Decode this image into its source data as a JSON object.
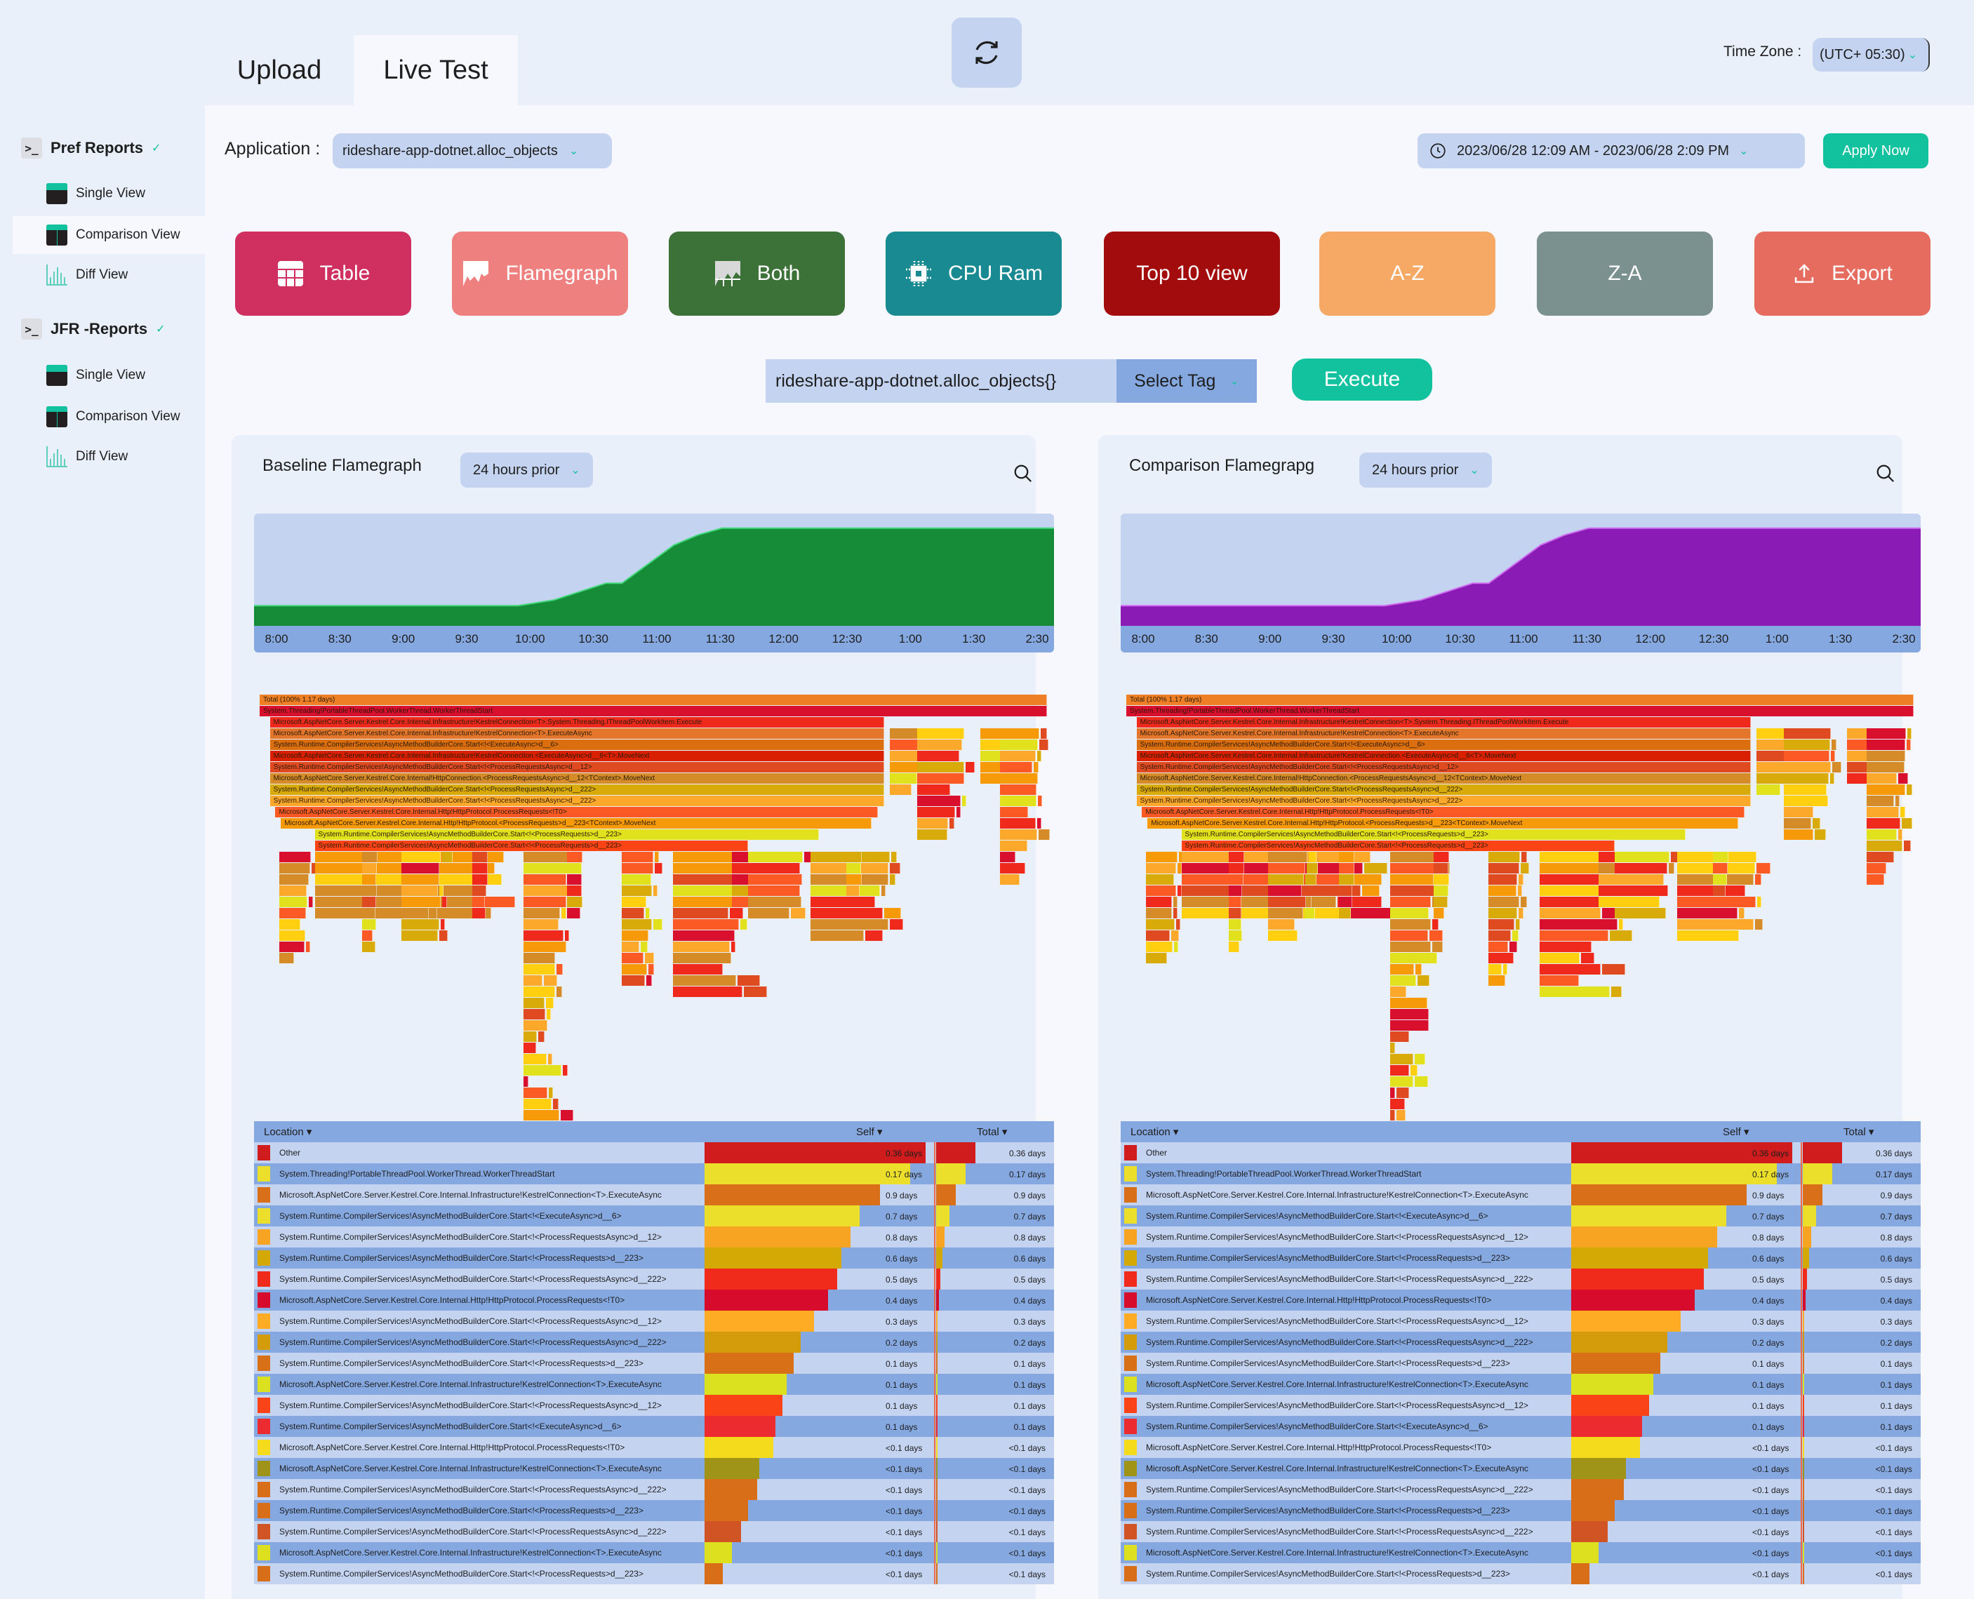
{
  "tabs": [
    {
      "label": "Upload",
      "active": false
    },
    {
      "label": "Live Test",
      "active": true
    }
  ],
  "refresh_icon": "refresh-icon",
  "timezone": {
    "label": "Time Zone :",
    "value": "(UTC+ 05:30)"
  },
  "sidebar": {
    "groups": [
      {
        "title": "Pref Reports",
        "items": [
          {
            "label": "Single View",
            "icon": "single-view-icon",
            "active": false
          },
          {
            "label": "Comparison View",
            "icon": "comparison-view-icon",
            "active": true
          },
          {
            "label": "Diff View",
            "icon": "diff-view-icon",
            "active": false
          }
        ]
      },
      {
        "title": "JFR -Reports",
        "items": [
          {
            "label": "Single View",
            "icon": "single-view-icon",
            "active": false
          },
          {
            "label": "Comparison View",
            "icon": "comparison-view-icon",
            "active": false
          },
          {
            "label": "Diff View",
            "icon": "diff-view-icon",
            "active": false
          }
        ]
      }
    ]
  },
  "application": {
    "label": "Application :",
    "value": "rideshare-app-dotnet.alloc_objects"
  },
  "date_range": {
    "value": "2023/06/28  12:09 AM - 2023/06/28  2:09 PM"
  },
  "apply_label": "Apply Now",
  "view_buttons": [
    {
      "label": "Table",
      "icon": "table-icon",
      "color": "#d03060"
    },
    {
      "label": "Flamegraph",
      "icon": "flamegraph-icon",
      "color": "#ee8080"
    },
    {
      "label": "Both",
      "icon": "both-icon",
      "color": "#3c7138"
    },
    {
      "label": "CPU Ram",
      "icon": "cpu-icon",
      "color": "#1a8a92"
    },
    {
      "label": "Top 10 view",
      "icon": "",
      "color": "#a20c0c"
    },
    {
      "label": "A-Z",
      "icon": "",
      "color": "#f5a964"
    },
    {
      "label": "Z-A",
      "icon": "",
      "color": "#7a9190"
    },
    {
      "label": "Export",
      "icon": "export-icon",
      "color": "#e66c60"
    }
  ],
  "query": {
    "value": "rideshare-app-dotnet.alloc_objects{}",
    "tag_label": "Select Tag",
    "execute_label": "Execute"
  },
  "panels": [
    {
      "title": "Baseline Flamegraph",
      "range": "24 hours  prior",
      "fill": "#178c38",
      "stroke": "#42d97a"
    },
    {
      "title": "Comparison Flamegrapg",
      "range": "24 hours  prior",
      "fill": "#8a1bb5",
      "stroke": "#d070f0"
    }
  ],
  "timeline": {
    "ticks": [
      "8:00",
      "8:30",
      "9:00",
      "9:30",
      "10:00",
      "10:30",
      "11:00",
      "11:30",
      "12:00",
      "12:30",
      "1:00",
      "1:30",
      "2:30"
    ],
    "points": [
      [
        0,
        0.18
      ],
      [
        0.33,
        0.18
      ],
      [
        0.375,
        0.23
      ],
      [
        0.44,
        0.38
      ],
      [
        0.46,
        0.38
      ],
      [
        0.525,
        0.72
      ],
      [
        0.555,
        0.81
      ],
      [
        0.585,
        0.87
      ],
      [
        1.0,
        0.87
      ]
    ]
  },
  "flamegraph": {
    "rows": [
      {
        "label": "Total  (100% 1.17 days)",
        "start": 0.0,
        "width": 1.0,
        "color": "#ef7f24"
      },
      {
        "label": "System.Threading!PortableThreadPool.WorkerThread.WorkerThreadStart",
        "start": 0.0,
        "width": 1.0,
        "color": "#d80f2d"
      },
      {
        "label": "Microsoft.AspNetCore.Server.Kestrel.Core.Internal.Infrastructure!KestrelConnection<T>.System.Threading.IThreadPoolWorkItem.Execute",
        "start": 0.013,
        "width": 0.78,
        "color": "#ef2a1c"
      },
      {
        "label": "Microsoft.AspNetCore.Server.Kestrel.Core.Internal.Infrastructure!KestrelConnection<T>.ExecuteAsync",
        "start": 0.013,
        "width": 0.78,
        "color": "#e3762a"
      },
      {
        "label": "System.Runtime.CompilerServices!AsyncMethodBuilderCore.Start<!<ExecuteAsync>d__6>",
        "start": 0.013,
        "width": 0.78,
        "color": "#db6f10"
      },
      {
        "label": "Microsoft.AspNetCore.Server.Kestrel.Core.Internal.Infrastructure!KestrelConnection.<ExecuteAsync>d__6<T>.MoveNext",
        "start": 0.013,
        "width": 0.78,
        "color": "#d92000"
      },
      {
        "label": "System.Runtime.CompilerServices!AsyncMethodBuilderCore.Start<!<ProcessRequestsAsync>d__12>",
        "start": 0.013,
        "width": 0.78,
        "color": "#e04a20"
      },
      {
        "label": "Microsoft.AspNetCore.Server.Kestrel.Core.Internal!HttpConnection.<ProcessRequestsAsync>d__12<TContext>.MoveNext",
        "start": 0.013,
        "width": 0.78,
        "color": "#d58b28"
      },
      {
        "label": "System.Runtime.CompilerServices!AsyncMethodBuilderCore.Start<!<ProcessRequestsAsync>d__222>",
        "start": 0.013,
        "width": 0.78,
        "color": "#d8aa0a"
      },
      {
        "label": "System.Runtime.CompilerServices!AsyncMethodBuilderCore.Start<!<ProcessRequestsAsync>d__222>",
        "start": 0.013,
        "width": 0.78,
        "color": "#fca82a"
      },
      {
        "label": "Microsoft.AspNetCore.Server.Kestrel.Core.Internal.Http!HttpProtocol.ProcessRequests<!T0>",
        "start": 0.02,
        "width": 0.765,
        "color": "#fb5a24"
      },
      {
        "label": "Microsoft.AspNetCore.Server.Kestrel.Core.Internal.Http!HttpProtocol.<ProcessRequests>d__223<TContext>.MoveNext",
        "start": 0.027,
        "width": 0.75,
        "color": "#f69a0a"
      },
      {
        "label": "System.Runtime.CompilerServices!AsyncMethodBuilderCore.Start<!<ProcessRequests>d__223>",
        "start": 0.07,
        "width": 0.64,
        "color": "#e1e11e"
      },
      {
        "label": "System.Runtime.CompilerServices!AsyncMethodBuilderCore.Start<!<ProcessRequests>d__223>",
        "start": 0.07,
        "width": 0.55,
        "color": "#fb4416"
      }
    ]
  },
  "table": {
    "headers": {
      "location": "Location ▾",
      "self": "Self ▾",
      "total": "Total ▾"
    },
    "rows": [
      {
        "color": "#d01c1c",
        "location": "Other",
        "self": "0.36 days",
        "total": "0.36 days",
        "self_frac": 0.97,
        "total_frac": 0.36
      },
      {
        "color": "#ebdf2c",
        "location": "System.Threading!PortableThreadPool.WorkerThread.WorkerThreadStart",
        "self": "0.17 days",
        "total": "0.17 days",
        "self_frac": 0.9,
        "total_frac": 0.27
      },
      {
        "color": "#d96f18",
        "location": "Microsoft.AspNetCore.Server.Kestrel.Core.Internal.Infrastructure!KestrelConnection<T>.ExecuteAsync",
        "self": "0.9 days",
        "total": "0.9 days",
        "self_frac": 0.77,
        "total_frac": 0.18
      },
      {
        "color": "#ebdf2c",
        "location": "System.Runtime.CompilerServices!AsyncMethodBuilderCore.Start<!<ExecuteAsync>d__6>",
        "self": "0.7 days",
        "total": "0.7 days",
        "self_frac": 0.68,
        "total_frac": 0.12
      },
      {
        "color": "#f7a423",
        "location": "System.Runtime.CompilerServices!AsyncMethodBuilderCore.Start<!<ProcessRequestsAsync>d__12>",
        "self": "0.8 days",
        "total": "0.8 days",
        "self_frac": 0.64,
        "total_frac": 0.08
      },
      {
        "color": "#d4a906",
        "location": "System.Runtime.CompilerServices!AsyncMethodBuilderCore.Start<!<ProcessRequests>d__223>",
        "self": "0.6 days",
        "total": "0.6 days",
        "self_frac": 0.6,
        "total_frac": 0.06
      },
      {
        "color": "#f12b1c",
        "location": "System.Runtime.CompilerServices!AsyncMethodBuilderCore.Start<!<ProcessRequestsAsync>d__222>",
        "self": "0.5 days",
        "total": "0.5 days",
        "self_frac": 0.58,
        "total_frac": 0.04
      },
      {
        "color": "#d70c2c",
        "location": "Microsoft.AspNetCore.Server.Kestrel.Core.Internal.Http!HttpProtocol.ProcessRequests<!T0>",
        "self": "0.4 days",
        "total": "0.4 days",
        "self_frac": 0.54,
        "total_frac": 0.025
      },
      {
        "color": "#fdac24",
        "location": "System.Runtime.CompilerServices!AsyncMethodBuilderCore.Start<!<ProcessRequestsAsync>d__12>",
        "self": "0.3 days",
        "total": "0.3 days",
        "self_frac": 0.48,
        "total_frac": 0.01
      },
      {
        "color": "#d49b0a",
        "location": "System.Runtime.CompilerServices!AsyncMethodBuilderCore.Start<!<ProcessRequestsAsync>d__222>",
        "self": "0.2 days",
        "total": "0.2 days",
        "self_frac": 0.42,
        "total_frac": 0.01
      },
      {
        "color": "#d87018",
        "location": "System.Runtime.CompilerServices!AsyncMethodBuilderCore.Start<!<ProcessRequests>d__223>",
        "self": "0.1 days",
        "total": "0.1 days",
        "self_frac": 0.39,
        "total_frac": 0.01
      },
      {
        "color": "#dbe11e",
        "location": "Microsoft.AspNetCore.Server.Kestrel.Core.Internal.Infrastructure!KestrelConnection<T>.ExecuteAsync",
        "self": "0.1 days",
        "total": "0.1 days",
        "self_frac": 0.36,
        "total_frac": 0.01
      },
      {
        "color": "#fa4418",
        "location": "System.Runtime.CompilerServices!AsyncMethodBuilderCore.Start<!<ProcessRequestsAsync>d__12>",
        "self": "0.1 days",
        "total": "0.1 days",
        "self_frac": 0.34,
        "total_frac": 0.01
      },
      {
        "color": "#eb2b30",
        "location": "System.Runtime.CompilerServices!AsyncMethodBuilderCore.Start<!<ExecuteAsync>d__6>",
        "self": "0.1 days",
        "total": "0.1 days",
        "self_frac": 0.31,
        "total_frac": 0.01
      },
      {
        "color": "#f4dc1c",
        "location": "Microsoft.AspNetCore.Server.Kestrel.Core.Internal.Http!HttpProtocol.ProcessRequests<!T0>",
        "self": "<0.1 days",
        "total": "<0.1 days",
        "self_frac": 0.3,
        "total_frac": 0.01
      },
      {
        "color": "#a09418",
        "location": "Microsoft.AspNetCore.Server.Kestrel.Core.Internal.Infrastructure!KestrelConnection<T>.ExecuteAsync",
        "self": "<0.1 days",
        "total": "<0.1 days",
        "self_frac": 0.24,
        "total_frac": 0.01
      },
      {
        "color": "#d96e18",
        "location": "System.Runtime.CompilerServices!AsyncMethodBuilderCore.Start<!<ProcessRequestsAsync>d__222>",
        "self": "<0.1 days",
        "total": "<0.1 days",
        "self_frac": 0.23,
        "total_frac": 0.01
      },
      {
        "color": "#d96e18",
        "location": "System.Runtime.CompilerServices!AsyncMethodBuilderCore.Start<!<ProcessRequests>d__223>",
        "self": "<0.1 days",
        "total": "<0.1 days",
        "self_frac": 0.19,
        "total_frac": 0.01
      },
      {
        "color": "#d05424",
        "location": "System.Runtime.CompilerServices!AsyncMethodBuilderCore.Start<!<ProcessRequestsAsync>d__222>",
        "self": "<0.1 days",
        "total": "<0.1 days",
        "self_frac": 0.16,
        "total_frac": 0.01
      },
      {
        "color": "#dde01e",
        "location": "Microsoft.AspNetCore.Server.Kestrel.Core.Internal.Infrastructure!KestrelConnection<T>.ExecuteAsync",
        "self": "<0.1 days",
        "total": "<0.1 days",
        "self_frac": 0.12,
        "total_frac": 0.01
      },
      {
        "color": "#d96e18",
        "location": "System.Runtime.CompilerServices!AsyncMethodBuilderCore.Start<!<ProcessRequests>d__223>",
        "self": "<0.1 days",
        "total": "<0.1 days",
        "self_frac": 0.08,
        "total_frac": 0.01
      }
    ]
  }
}
